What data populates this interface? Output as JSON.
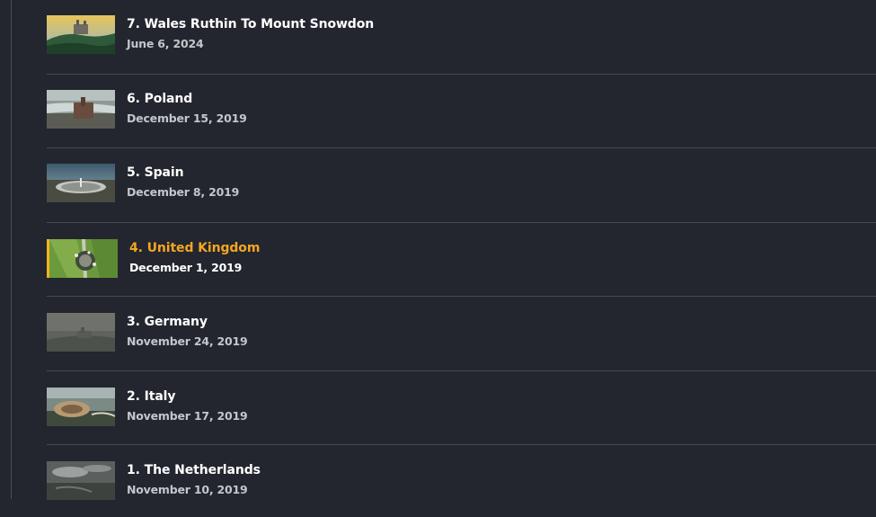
{
  "episodes": [
    {
      "title": "7. Wales Ruthin To Mount Snowdon",
      "date": "June 6, 2024",
      "thumbnail_icon": "castle-on-hill-image",
      "active": false
    },
    {
      "title": "6. Poland",
      "date": "December 15, 2019",
      "thumbnail_icon": "river-castle-image",
      "active": false
    },
    {
      "title": "5. Spain",
      "date": "December 8, 2019",
      "thumbnail_icon": "solar-field-image",
      "active": false
    },
    {
      "title": "4. United Kingdom",
      "date": "December 1, 2019",
      "thumbnail_icon": "stone-circle-aerial-image",
      "active": true
    },
    {
      "title": "3. Germany",
      "date": "November 24, 2019",
      "thumbnail_icon": "foggy-ruins-image",
      "active": false
    },
    {
      "title": "2. Italy",
      "date": "November 17, 2019",
      "thumbnail_icon": "colosseum-image",
      "active": false
    },
    {
      "title": "1. The Netherlands",
      "date": "November 10, 2019",
      "thumbnail_icon": "cloudy-landscape-image",
      "active": false
    }
  ],
  "colors": {
    "background": "#23262e",
    "divider": "#45484f",
    "active_title": "#f5a623",
    "active_marker": "#f5b41b",
    "date_text": "#c4c6cb"
  }
}
